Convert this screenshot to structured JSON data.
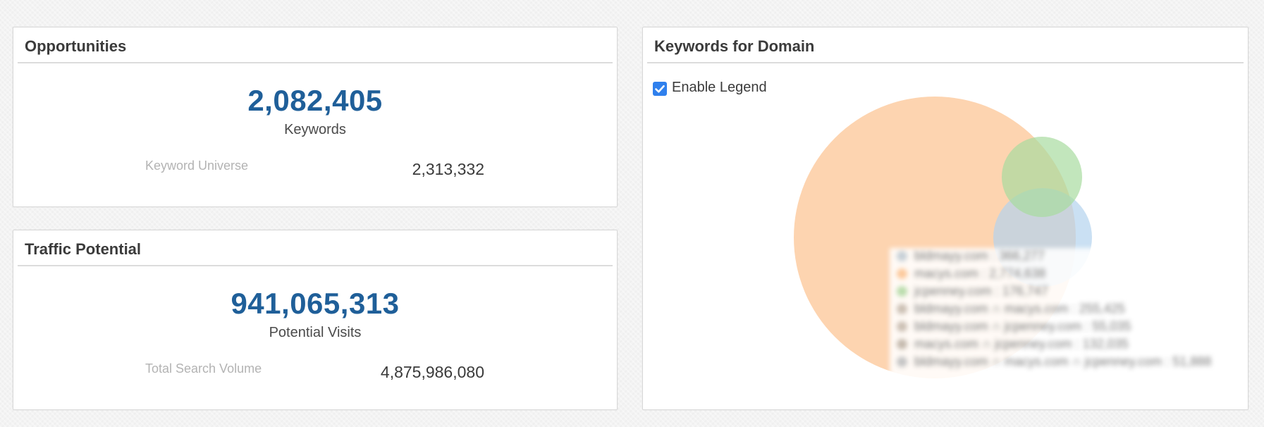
{
  "opportunities": {
    "title": "Opportunities",
    "big_value": "2,082,405",
    "big_label": "Keywords",
    "sub_label": "Keyword Universe",
    "sub_value": "2,313,332"
  },
  "traffic": {
    "title": "Traffic Potential",
    "big_value": "941,065,313",
    "big_label": "Potential Visits",
    "sub_label": "Total Search Volume",
    "sub_value": "4,875,986,080"
  },
  "keywords_domain": {
    "title": "Keywords for Domain",
    "enable_legend_label": "Enable Legend",
    "enable_legend_checked": true,
    "venn_colors": {
      "macys": "#fcc89a",
      "jcpenney": "#a8dba0",
      "bloomingdales": "#b3d3ee"
    },
    "legend": [
      {
        "text": "bldmayy.com : 366,277",
        "color": "#c6cfd6"
      },
      {
        "text": "macys.com : 2,774,638",
        "color": "#fcc89a"
      },
      {
        "text": "jcpenney.com : 176,747",
        "color": "#b9dcab"
      },
      {
        "text": "bldmayy.com ∩ macys.com : 255,425",
        "color": "#cbbfb3"
      },
      {
        "text": "bldmayy.com ∩ jcpenney.com : 55,035",
        "color": "#cbbfb3"
      },
      {
        "text": "macys.com ∩ jcpenney.com : 132,035",
        "color": "#c4b9ad"
      },
      {
        "text": "bldmayy.com ∩ macys.com ∩ jcpenney.com : 51,888",
        "color": "#c4c4c4"
      }
    ]
  }
}
